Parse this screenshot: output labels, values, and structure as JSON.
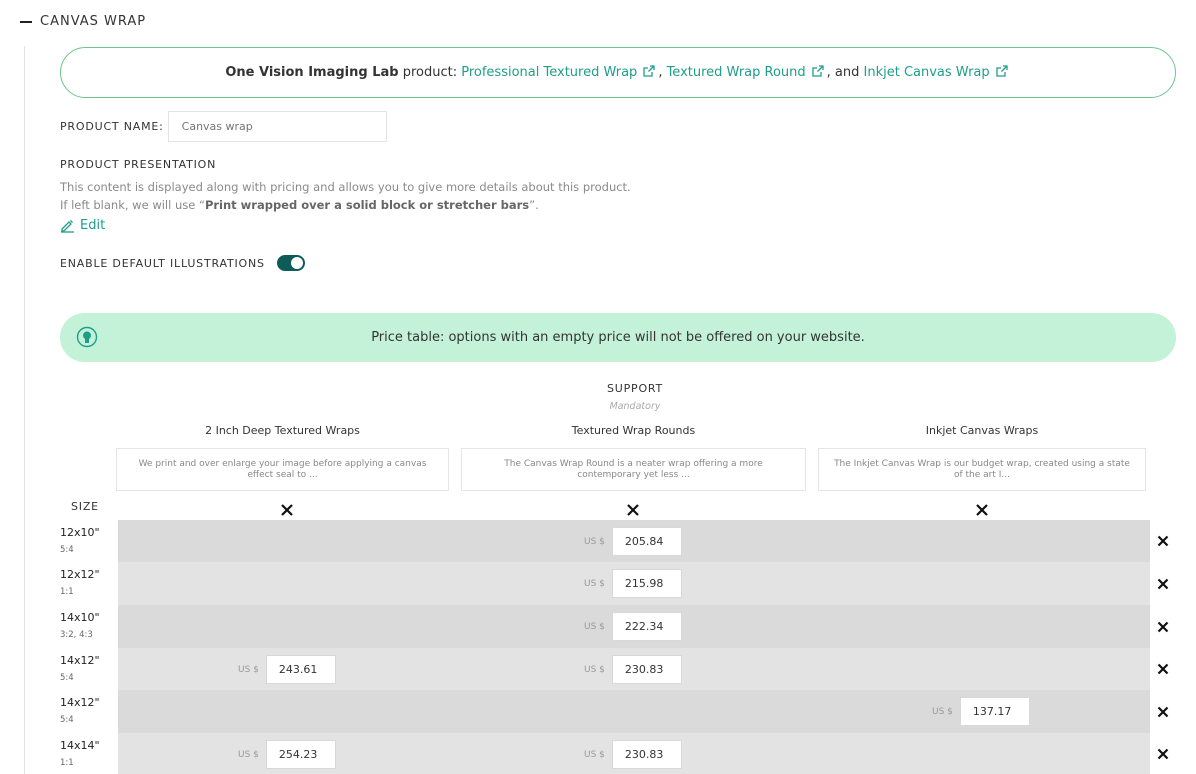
{
  "section": {
    "title": "CANVAS WRAP",
    "collapse_icon": "minus-icon"
  },
  "lab": {
    "name": "One Vision Imaging Lab",
    "product_prefix": " product: ",
    "links": [
      "Professional Textured Wrap",
      "Textured Wrap Round",
      "Inkjet Canvas Wrap"
    ],
    "sep_comma": ", ",
    "sep_and": ", and ",
    "link_icon": "external-link-icon"
  },
  "product_name": {
    "label": "PRODUCT NAME:",
    "placeholder": "Canvas wrap"
  },
  "presentation": {
    "label": "PRODUCT PRESENTATION",
    "line1": "This content is displayed along with pricing and allows you to give more details about this product.",
    "line2_prefix": "If left blank, we will use “",
    "line2_default": "Print wrapped over a solid block or stretcher bars",
    "line2_suffix": "”.",
    "edit_label": "Edit"
  },
  "illustrations": {
    "label": "ENABLE DEFAULT ILLUSTRATIONS",
    "enabled": true
  },
  "notice": {
    "text": "Price table: options with an empty price will not be offered on your website.",
    "icon": "lightbulb-icon"
  },
  "support": {
    "title": "SUPPORT",
    "subtitle": "Mandatory",
    "columns": [
      {
        "title": "2 Inch Deep Textured Wraps",
        "desc": "We print and over enlarge your image before applying a canvas effect seal to ..."
      },
      {
        "title": "Textured Wrap Rounds",
        "desc": "The Canvas Wrap Round is a neater wrap offering a more contemporary yet less ..."
      },
      {
        "title": "Inkjet Canvas Wraps",
        "desc": "The Inkjet Canvas Wrap is our budget wrap, created using a state of the art I..."
      }
    ]
  },
  "size_label": "SIZE",
  "currency": "US $",
  "rows": [
    {
      "size": "12x10\"",
      "ratio": "5:4",
      "prices": [
        "",
        "205.84",
        ""
      ]
    },
    {
      "size": "12x12\"",
      "ratio": "1:1",
      "prices": [
        "",
        "215.98",
        ""
      ]
    },
    {
      "size": "14x10\"",
      "ratio": "3:2, 4:3",
      "prices": [
        "",
        "222.34",
        ""
      ]
    },
    {
      "size": "14x12\"",
      "ratio": "5:4",
      "prices": [
        "243.61",
        "230.83",
        ""
      ]
    },
    {
      "size": "14x12\"",
      "ratio": "5:4",
      "prices": [
        "",
        "",
        "137.17"
      ]
    },
    {
      "size": "14x14\"",
      "ratio": "1:1",
      "prices": [
        "254.23",
        "230.83",
        ""
      ]
    }
  ],
  "colors": {
    "accent": "#1e9e8a",
    "toggle": "#0e5c57",
    "notice_bg": "#c4f2d8",
    "border_green": "#6cc58a",
    "row_dark": "#dadada",
    "row_light": "#e3e3e3"
  }
}
